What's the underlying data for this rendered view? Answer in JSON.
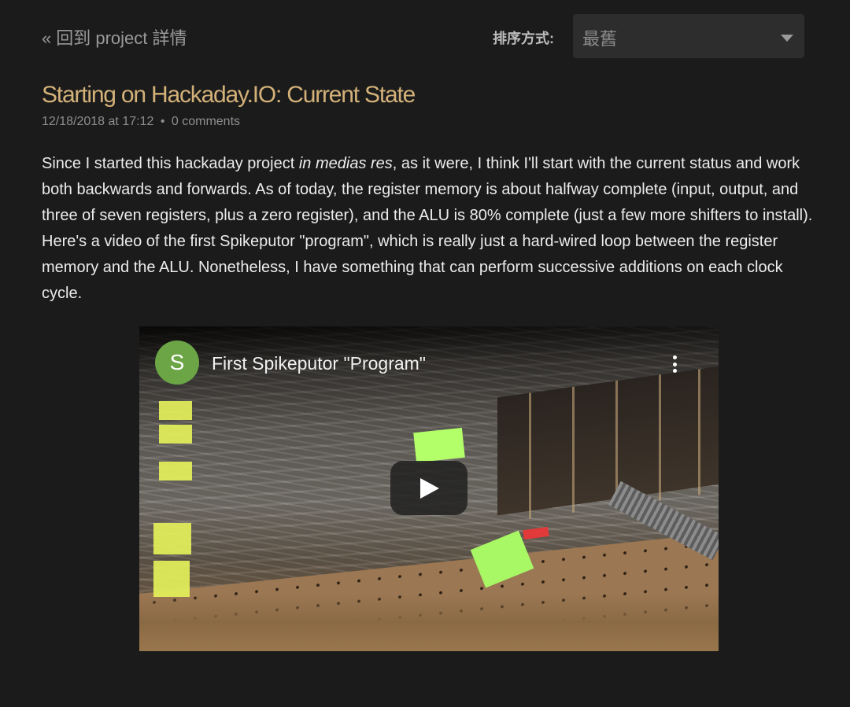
{
  "nav": {
    "back_chevron": "«",
    "back_label": "回到 project 詳情"
  },
  "sort": {
    "label": "排序方式:",
    "selected": "最舊"
  },
  "post": {
    "title": "Starting on Hackaday.IO: Current State",
    "date": "12/18/2018 at 17:12",
    "separator": "•",
    "comments": "0 comments",
    "body_part1": "Since I started this hackaday project ",
    "body_italic": "in medias res",
    "body_part2": ", as it were, I think I'll start with the current status and work both backwards and forwards. As of today, the register memory is about halfway complete (input, output, and three of seven registers, plus a zero register), and the ALU is 80% complete (just a few more shifters to install). Here's a video of the first Spikeputor \"program\", which is really just a hard-wired loop between the register memory and the ALU. Nonetheless, I have something that can perform successive additions on each clock cycle."
  },
  "video": {
    "channel_initial": "S",
    "title": "First Spikeputor \"Program\"",
    "icons": {
      "menu": "more-vert-icon",
      "play": "play-icon"
    },
    "colors": {
      "avatar": "#6ba546",
      "title_accent": "#d3b179"
    }
  }
}
